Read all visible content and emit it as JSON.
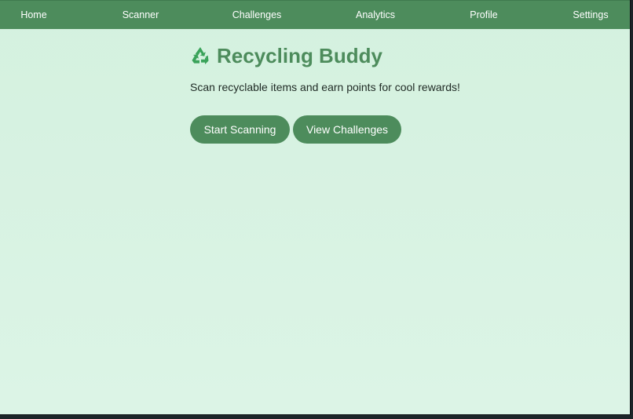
{
  "navbar": {
    "items": [
      {
        "label": "Home"
      },
      {
        "label": "Scanner"
      },
      {
        "label": "Challenges"
      },
      {
        "label": "Analytics"
      },
      {
        "label": "Profile"
      },
      {
        "label": "Settings"
      }
    ]
  },
  "header": {
    "icon": "recycle-icon",
    "title": "Recycling Buddy",
    "subtitle": "Scan recyclable items and earn points for cool rewards!"
  },
  "actions": {
    "start_label": "Start Scanning",
    "view_label": "View Challenges"
  },
  "colors": {
    "accent": "#4d8c5c",
    "background": "#d6f2e1",
    "icon": "#3aa35a"
  }
}
